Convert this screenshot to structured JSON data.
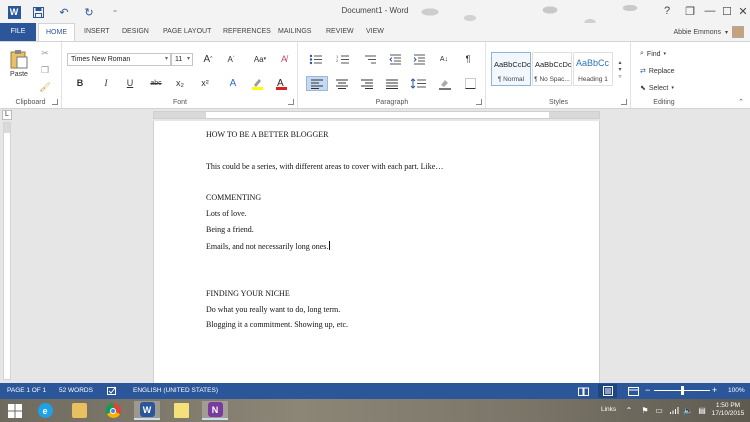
{
  "window": {
    "title": "Document1 - Word",
    "controls": {
      "help": "?",
      "restore": "❐",
      "minimize": "—",
      "maximize": "☐",
      "close": "✕"
    }
  },
  "quick_access": {
    "save": "save-icon",
    "undo": "undo-icon",
    "redo": "redo-icon"
  },
  "tabs": [
    "FILE",
    "HOME",
    "INSERT",
    "DESIGN",
    "PAGE LAYOUT",
    "REFERENCES",
    "MAILINGS",
    "REVIEW",
    "VIEW"
  ],
  "active_tab": "HOME",
  "account": {
    "user": "Abbie Emmons"
  },
  "ribbon": {
    "clipboard": {
      "label": "Clipboard",
      "paste": "Paste"
    },
    "font": {
      "label": "Font",
      "font_name": "Times New Roman",
      "font_size": "11",
      "bold": "B",
      "italic": "I",
      "underline": "U",
      "strike": "abc",
      "subscript": "x₂",
      "superscript": "x²",
      "grow": "A",
      "shrink": "A",
      "case": "Aa"
    },
    "paragraph": {
      "label": "Paragraph",
      "pilcrow": "¶"
    },
    "styles": {
      "label": "Styles",
      "items": [
        {
          "sample": "AaBbCcDc",
          "name": "¶ Normal"
        },
        {
          "sample": "AaBbCcDc",
          "name": "¶ No Spac..."
        },
        {
          "sample": "AaBbCc",
          "name": "Heading 1"
        }
      ]
    },
    "editing": {
      "label": "Editing",
      "find": "Find",
      "replace": "Replace",
      "select": "Select"
    }
  },
  "document": {
    "lines": [
      "HOW TO BE A BETTER BLOGGER",
      "This could be a series, with different areas to cover with each part. Like…",
      "COMMENTING",
      "Lots of love.",
      "Being a friend.",
      "Emails, and not necessarily long ones.",
      "FINDING YOUR NICHE",
      "Do what you really want to do, long term.",
      "Blogging it a commitment. Showing up, etc."
    ]
  },
  "status": {
    "page": "PAGE 1 OF 1",
    "words": "52 WORDS",
    "language": "ENGLISH (UNITED STATES)",
    "zoom": "100%",
    "zoom_minus": "−",
    "zoom_plus": "+"
  },
  "taskbar": {
    "apps": [
      "windows-start",
      "internet-explorer",
      "file-explorer",
      "chrome",
      "word",
      "sticky-notes",
      "onenote"
    ],
    "tray_label": "Links",
    "time": "1:50 PM",
    "date": "17/10/2015"
  },
  "colors": {
    "accent": "#2b579a"
  },
  "ruler": {
    "corner": "L"
  }
}
